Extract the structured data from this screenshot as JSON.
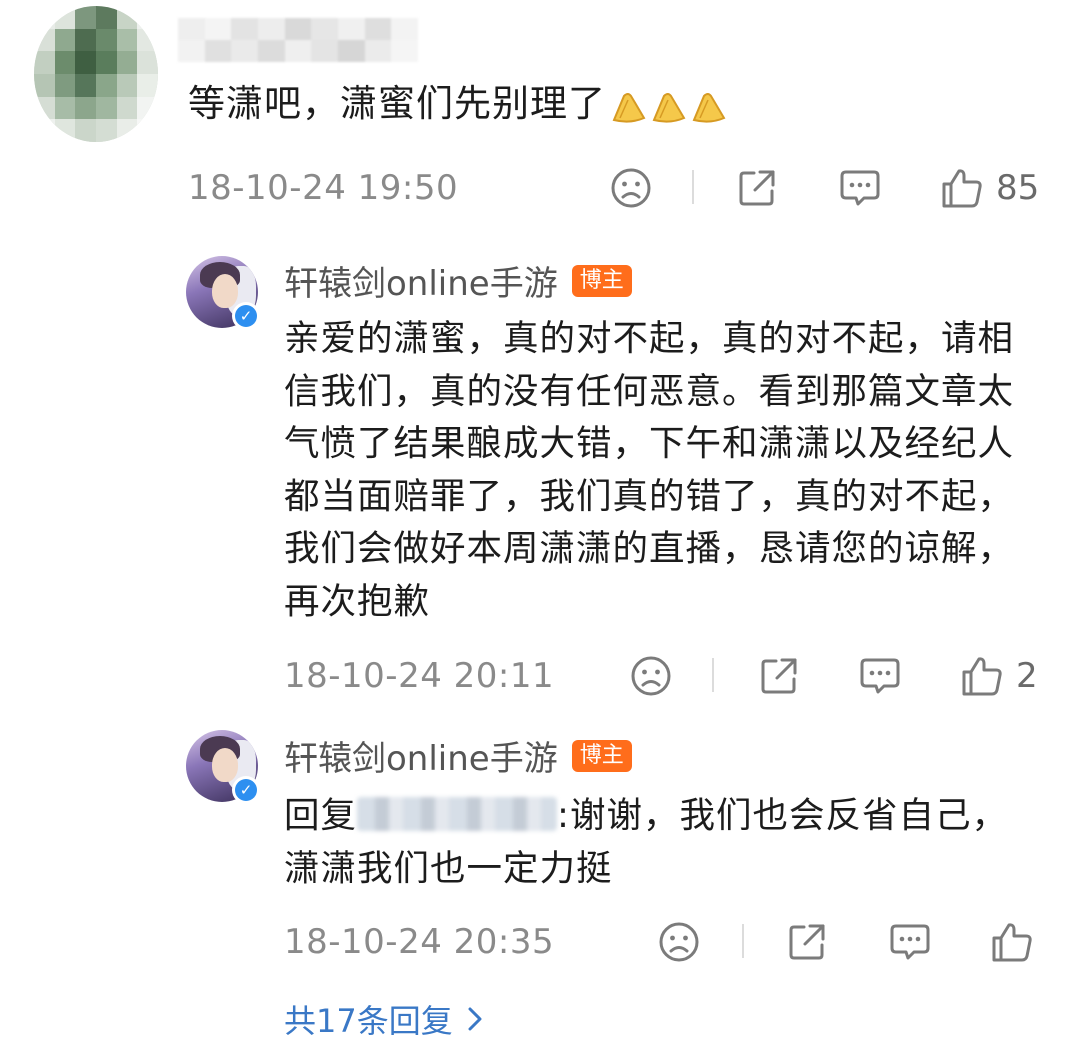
{
  "main_comment": {
    "text": "等潇吧，潇蜜们先别理了",
    "time": "18-10-24 19:50",
    "likes": "85",
    "emoji_count": 3
  },
  "replies": [
    {
      "author": "轩辕剑online手游",
      "badge": "博主",
      "text": "亲爱的潇蜜，真的对不起，真的对不起，请相信我们，真的没有任何恶意。看到那篇文章太气愤了结果酿成大错，下午和潇潇以及经纪人都当面赔罪了，我们真的错了，真的对不起，我们会做好本周潇潇的直播，恳请您的谅解，再次抱歉",
      "time": "18-10-24 20:11",
      "likes": "2"
    },
    {
      "author": "轩辕剑online手游",
      "badge": "博主",
      "reply_prefix": "回复",
      "text": ":谢谢，我们也会反省自己，潇潇我们也一定力挺",
      "time": "18-10-24 20:35",
      "likes": ""
    }
  ],
  "more_replies": "共17条回复",
  "colors": {
    "badge": "#ff6d1b",
    "link": "#3a78c6",
    "meta": "#8a8a8a",
    "verified": "#2d8ff0"
  },
  "icons": [
    "sad-face-icon",
    "share-icon",
    "comment-icon",
    "thumbs-up-icon",
    "chevron-right-icon",
    "clapping-hands-emoji"
  ]
}
